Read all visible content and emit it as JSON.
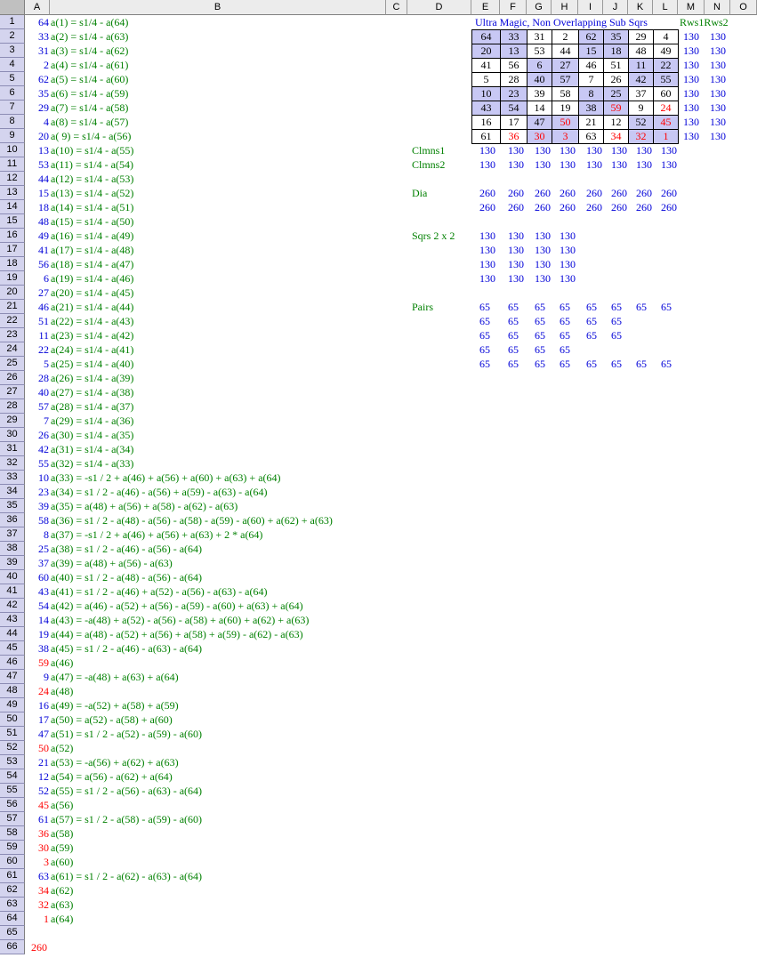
{
  "columns": [
    "A",
    "B",
    "C",
    "D",
    "E",
    "F",
    "G",
    "H",
    "I",
    "J",
    "K",
    "L",
    "M",
    "N",
    "O"
  ],
  "rows_count": 66,
  "colA_values": [
    64,
    33,
    31,
    2,
    62,
    35,
    29,
    4,
    20,
    13,
    53,
    44,
    15,
    18,
    48,
    49,
    41,
    56,
    6,
    27,
    46,
    51,
    11,
    22,
    5,
    28,
    40,
    57,
    7,
    26,
    42,
    55,
    10,
    23,
    39,
    58,
    8,
    25,
    37,
    60,
    43,
    54,
    14,
    19,
    38,
    59,
    9,
    24,
    16,
    17,
    47,
    50,
    21,
    12,
    52,
    45,
    61,
    36,
    30,
    3,
    63,
    34,
    32,
    1
  ],
  "colA_red_rows": [
    46,
    48,
    52,
    56,
    58,
    59,
    60,
    62,
    63,
    64
  ],
  "colB_formulas": [
    "a(1) = s1/4 - a(64)",
    "a(2) = s1/4 - a(63)",
    "a(3) = s1/4 - a(62)",
    "a(4) = s1/4 - a(61)",
    "a(5) = s1/4 - a(60)",
    "a(6) = s1/4 - a(59)",
    "a(7) = s1/4 - a(58)",
    "a(8) = s1/4 - a(57)",
    "a( 9) = s1/4 - a(56)",
    "a(10) = s1/4 - a(55)",
    "a(11) = s1/4 - a(54)",
    "a(12) = s1/4 - a(53)",
    "a(13) = s1/4 - a(52)",
    "a(14) = s1/4 - a(51)",
    "a(15) = s1/4 - a(50)",
    "a(16) = s1/4 - a(49)",
    "a(17) = s1/4 - a(48)",
    "a(18) = s1/4 - a(47)",
    "a(19) = s1/4 - a(46)",
    "a(20) = s1/4 - a(45)",
    "a(21) = s1/4 - a(44)",
    "a(22) = s1/4 - a(43)",
    "a(23) = s1/4 - a(42)",
    "a(24) = s1/4 - a(41)",
    "a(25) = s1/4 - a(40)",
    "a(26) = s1/4 - a(39)",
    "a(27) = s1/4 - a(38)",
    "a(28) = s1/4 - a(37)",
    "a(29) = s1/4 - a(36)",
    "a(30) = s1/4 - a(35)",
    "a(31) = s1/4 - a(34)",
    "a(32) = s1/4 - a(33)",
    "a(33) = -s1 / 2 + a(46) + a(56) + a(60) + a(63) + a(64)",
    "a(34) = s1 / 2 - a(46) - a(56) + a(59) - a(63) - a(64)",
    "a(35) = a(48) + a(56) + a(58) - a(62) - a(63)",
    "a(36) = s1 / 2 - a(48) - a(56) - a(58) - a(59) - a(60) + a(62) + a(63)",
    "a(37) = -s1 / 2 + a(46) + a(56) + a(63) + 2 * a(64)",
    "a(38) = s1 / 2 - a(46) - a(56) - a(64)",
    "a(39) = a(48) + a(56) - a(63)",
    "a(40) = s1 / 2 - a(48) - a(56) - a(64)",
    "a(41) = s1 / 2 - a(46) + a(52) - a(56) - a(63) - a(64)",
    "a(42) = a(46) - a(52) + a(56) - a(59) - a(60) + a(63) + a(64)",
    "a(43) = -a(48) + a(52) - a(56) - a(58) + a(60) + a(62) + a(63)",
    "a(44) = a(48) - a(52) + a(56) + a(58) + a(59) - a(62) - a(63)",
    "a(45) = s1 / 2 - a(46) - a(63) - a(64)",
    "a(46)",
    "a(47) = -a(48) + a(63) + a(64)",
    "a(48)",
    "a(49) = -a(52) + a(58) + a(59)",
    "a(50) = a(52) - a(58) + a(60)",
    "a(51) = s1 / 2 - a(52) - a(59) - a(60)",
    "a(52)",
    "a(53) = -a(56) + a(62) + a(63)",
    "a(54) = a(56) - a(62) + a(64)",
    "a(55) = s1 / 2 - a(56) - a(63) - a(64)",
    "a(56)",
    "a(57) = s1 / 2 - a(58) - a(59) - a(60)",
    "a(58)",
    "a(59)",
    "a(60)",
    "a(61) = s1 / 2 - a(62) - a(63) - a(64)",
    "a(62)",
    "a(63)",
    "a(64)"
  ],
  "row66_value": "260",
  "square": {
    "title": "Ultra Magic, Non Overlapping Sub Sqrs",
    "rows_label": "Rws1Rws2",
    "cells": [
      [
        64,
        33,
        31,
        2,
        62,
        35,
        29,
        4
      ],
      [
        20,
        13,
        53,
        44,
        15,
        18,
        48,
        49
      ],
      [
        41,
        56,
        6,
        27,
        46,
        51,
        11,
        22
      ],
      [
        5,
        28,
        40,
        57,
        7,
        26,
        42,
        55
      ],
      [
        10,
        23,
        39,
        58,
        8,
        25,
        37,
        60
      ],
      [
        43,
        54,
        14,
        19,
        38,
        59,
        9,
        24
      ],
      [
        16,
        17,
        47,
        50,
        21,
        12,
        52,
        45
      ],
      [
        61,
        36,
        30,
        3,
        63,
        34,
        32,
        1
      ]
    ],
    "highlight": [
      [
        true,
        true,
        false,
        false,
        true,
        true,
        false,
        false
      ],
      [
        true,
        true,
        false,
        false,
        true,
        true,
        false,
        false
      ],
      [
        false,
        false,
        true,
        true,
        false,
        false,
        true,
        true
      ],
      [
        false,
        false,
        true,
        true,
        false,
        false,
        true,
        true
      ],
      [
        true,
        true,
        false,
        false,
        true,
        true,
        false,
        false
      ],
      [
        true,
        true,
        false,
        false,
        true,
        true,
        false,
        false
      ],
      [
        false,
        false,
        true,
        true,
        false,
        false,
        true,
        true
      ],
      [
        false,
        false,
        true,
        true,
        false,
        false,
        true,
        true
      ]
    ],
    "red": [
      [
        false,
        false,
        false,
        false,
        false,
        false,
        false,
        false
      ],
      [
        false,
        false,
        false,
        false,
        false,
        false,
        false,
        false
      ],
      [
        false,
        false,
        false,
        false,
        false,
        false,
        false,
        false
      ],
      [
        false,
        false,
        false,
        false,
        false,
        false,
        false,
        false
      ],
      [
        false,
        false,
        false,
        false,
        false,
        false,
        false,
        false
      ],
      [
        false,
        false,
        false,
        false,
        false,
        true,
        false,
        true
      ],
      [
        false,
        false,
        false,
        true,
        false,
        false,
        false,
        true
      ],
      [
        false,
        true,
        true,
        true,
        false,
        true,
        true,
        true
      ]
    ],
    "row_sums": [
      [
        130,
        130
      ],
      [
        130,
        130
      ],
      [
        130,
        130
      ],
      [
        130,
        130
      ],
      [
        130,
        130
      ],
      [
        130,
        130
      ],
      [
        130,
        130
      ],
      [
        130,
        130
      ]
    ]
  },
  "labels": {
    "clmns1": "Clmns1",
    "clmns2": "Clmns2",
    "dia": "Dia",
    "sqrs": "Sqrs 2 x 2",
    "pairs": "Pairs"
  },
  "clmns1_values": [
    "130",
    "130",
    "130",
    "130",
    "130",
    "130",
    "130",
    "130"
  ],
  "clmns2_values": [
    "130",
    "130",
    "130",
    "130",
    "130",
    "130",
    "130",
    "130"
  ],
  "dia_values": [
    [
      "260",
      "260",
      "260",
      "260",
      "260",
      "260",
      "260",
      "260"
    ],
    [
      "260",
      "260",
      "260",
      "260",
      "260",
      "260",
      "260",
      "260"
    ]
  ],
  "sqrs_values": [
    [
      "130",
      "130",
      "130",
      "130"
    ],
    [
      "130",
      "130",
      "130",
      "130"
    ],
    [
      "130",
      "130",
      "130",
      "130"
    ],
    [
      "130",
      "130",
      "130",
      "130"
    ]
  ],
  "pairs_values": [
    [
      "65",
      "65",
      "65",
      "65",
      "65",
      "65",
      "65",
      "65"
    ],
    [
      "65",
      "65",
      "65",
      "65",
      "65",
      "65"
    ],
    [
      "65",
      "65",
      "65",
      "65",
      "65",
      "65"
    ],
    [
      "65",
      "65",
      "65",
      "65"
    ],
    [
      "65",
      "65",
      "65",
      "65",
      "65",
      "65",
      "65",
      "65"
    ]
  ],
  "colors": {
    "number": "#0000d8",
    "formula": "#008000",
    "highlight_red": "#ff0000",
    "square_fill": "#c8c8f4",
    "row_header": "#d4d4ee"
  }
}
